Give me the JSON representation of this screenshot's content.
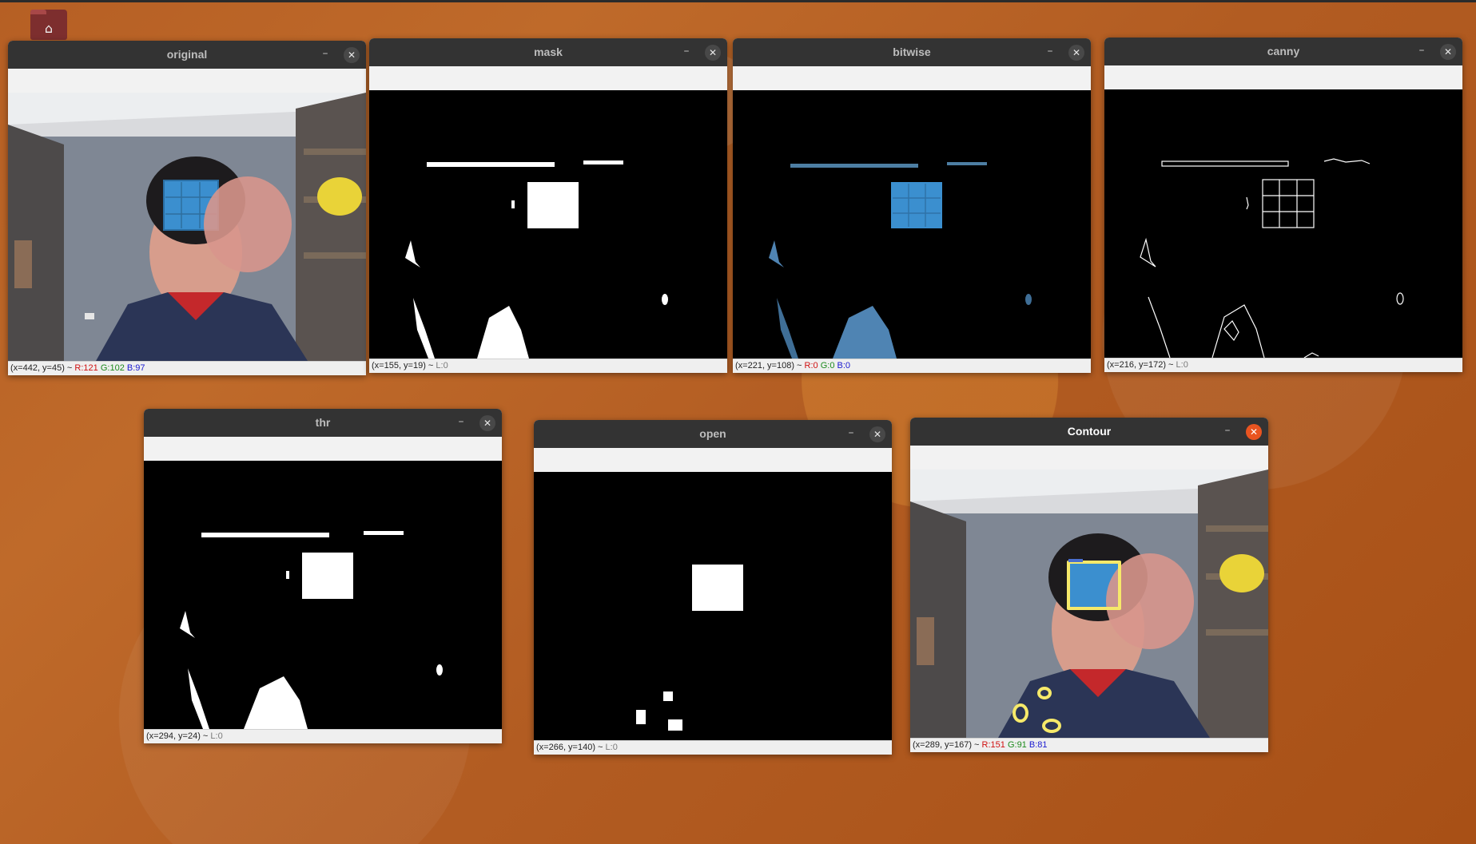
{
  "desktop": {
    "home_icon": "home-icon",
    "accent": "#e95420"
  },
  "windows": {
    "original": {
      "title": "original",
      "status_prefix": "(x=442, y=45) ~ ",
      "status_r": "R:121",
      "status_g": "G:102",
      "status_b": "B:97"
    },
    "mask": {
      "title": "mask",
      "status_prefix": "(x=155, y=19) ~ ",
      "status_l": "L:0"
    },
    "bitwise": {
      "title": "bitwise",
      "status_prefix": "(x=221, y=108) ~ ",
      "status_r": "R:0",
      "status_g": "G:0",
      "status_b": "B:0"
    },
    "canny": {
      "title": "canny",
      "status_prefix": "(x=216, y=172) ~ ",
      "status_l": "L:0"
    },
    "thr": {
      "title": "thr",
      "status_prefix": "(x=294, y=24) ~ ",
      "status_l": "L:0"
    },
    "open": {
      "title": "open",
      "status_prefix": "(x=266, y=140) ~ ",
      "status_l": "L:0"
    },
    "contour": {
      "title": "Contour",
      "status_prefix": "(x=289, y=167) ~ ",
      "status_r": "R:151",
      "status_g": "G:91",
      "status_b": "B:81"
    }
  },
  "controls": {
    "minimize_glyph": "–",
    "close_glyph": "✕"
  }
}
